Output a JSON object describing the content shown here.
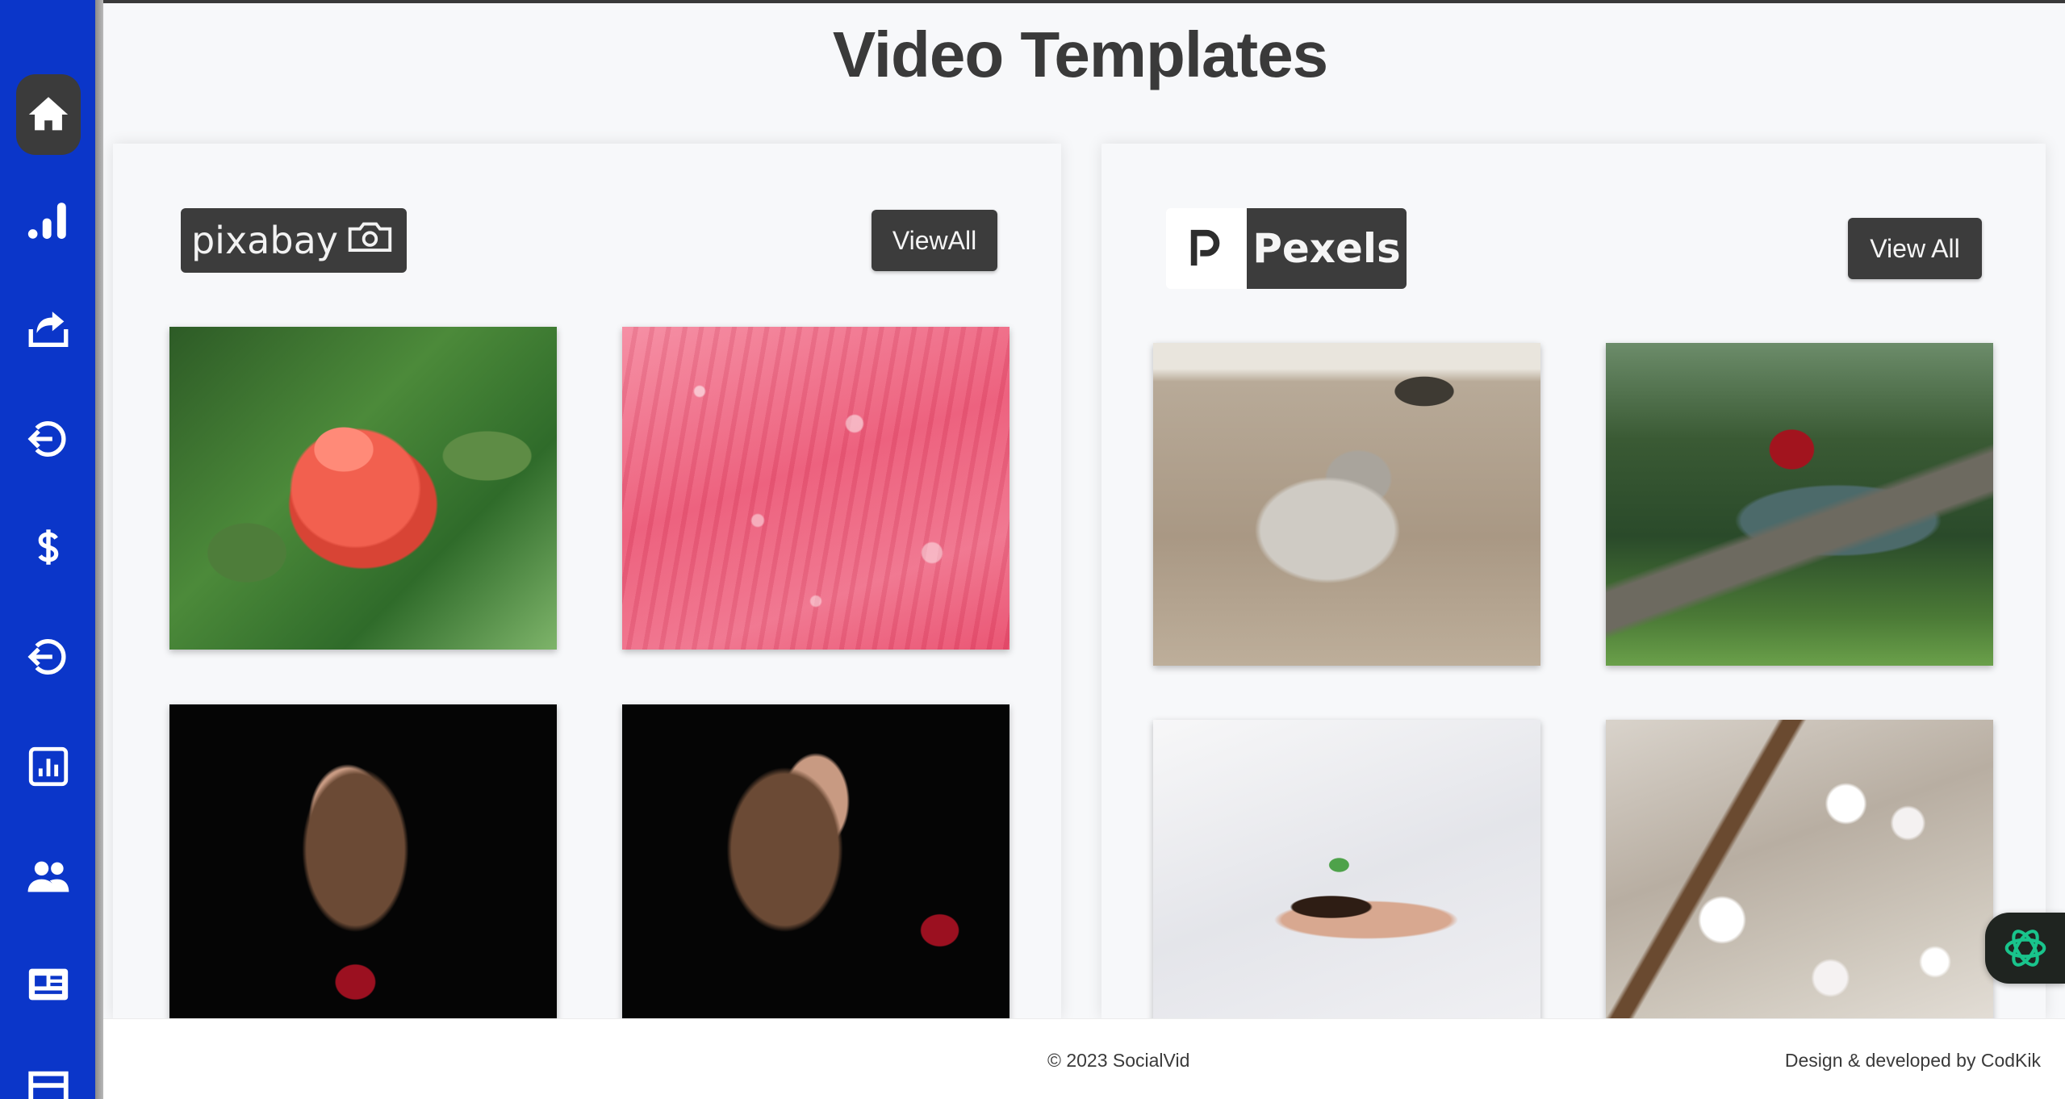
{
  "header": {
    "title": "Video Templates"
  },
  "sidebar": {
    "items": [
      {
        "icon": "home-icon",
        "active": true
      },
      {
        "icon": "bar-chart-icon",
        "active": false
      },
      {
        "icon": "share-upload-icon",
        "active": false
      },
      {
        "icon": "logout-arrow-icon",
        "active": false
      },
      {
        "icon": "dollar-icon",
        "active": false
      },
      {
        "icon": "logout-arrow-icon",
        "active": false
      },
      {
        "icon": "report-chart-icon",
        "active": false
      },
      {
        "icon": "users-icon",
        "active": false
      },
      {
        "icon": "id-card-icon",
        "active": false
      },
      {
        "icon": "layout-icon",
        "active": false
      }
    ],
    "colors": {
      "background": "#0b36c9",
      "active": "#3b3b3b"
    }
  },
  "panels": {
    "pixabay": {
      "logo_text": "pixabay",
      "view_all_label": "ViewAll",
      "thumbnails": [
        "rose",
        "pink-petal",
        "woman-rose-1",
        "woman-rose-2"
      ]
    },
    "pexels": {
      "logo_text": "Pexels",
      "view_all_label": "View All",
      "thumbnails": [
        "seal-on-beach",
        "forest-river",
        "sprout-in-hands",
        "cherry-blossom"
      ]
    }
  },
  "footer": {
    "copyright": "© 2023 SocialVid",
    "credit": "Design & developed by CodKik"
  }
}
